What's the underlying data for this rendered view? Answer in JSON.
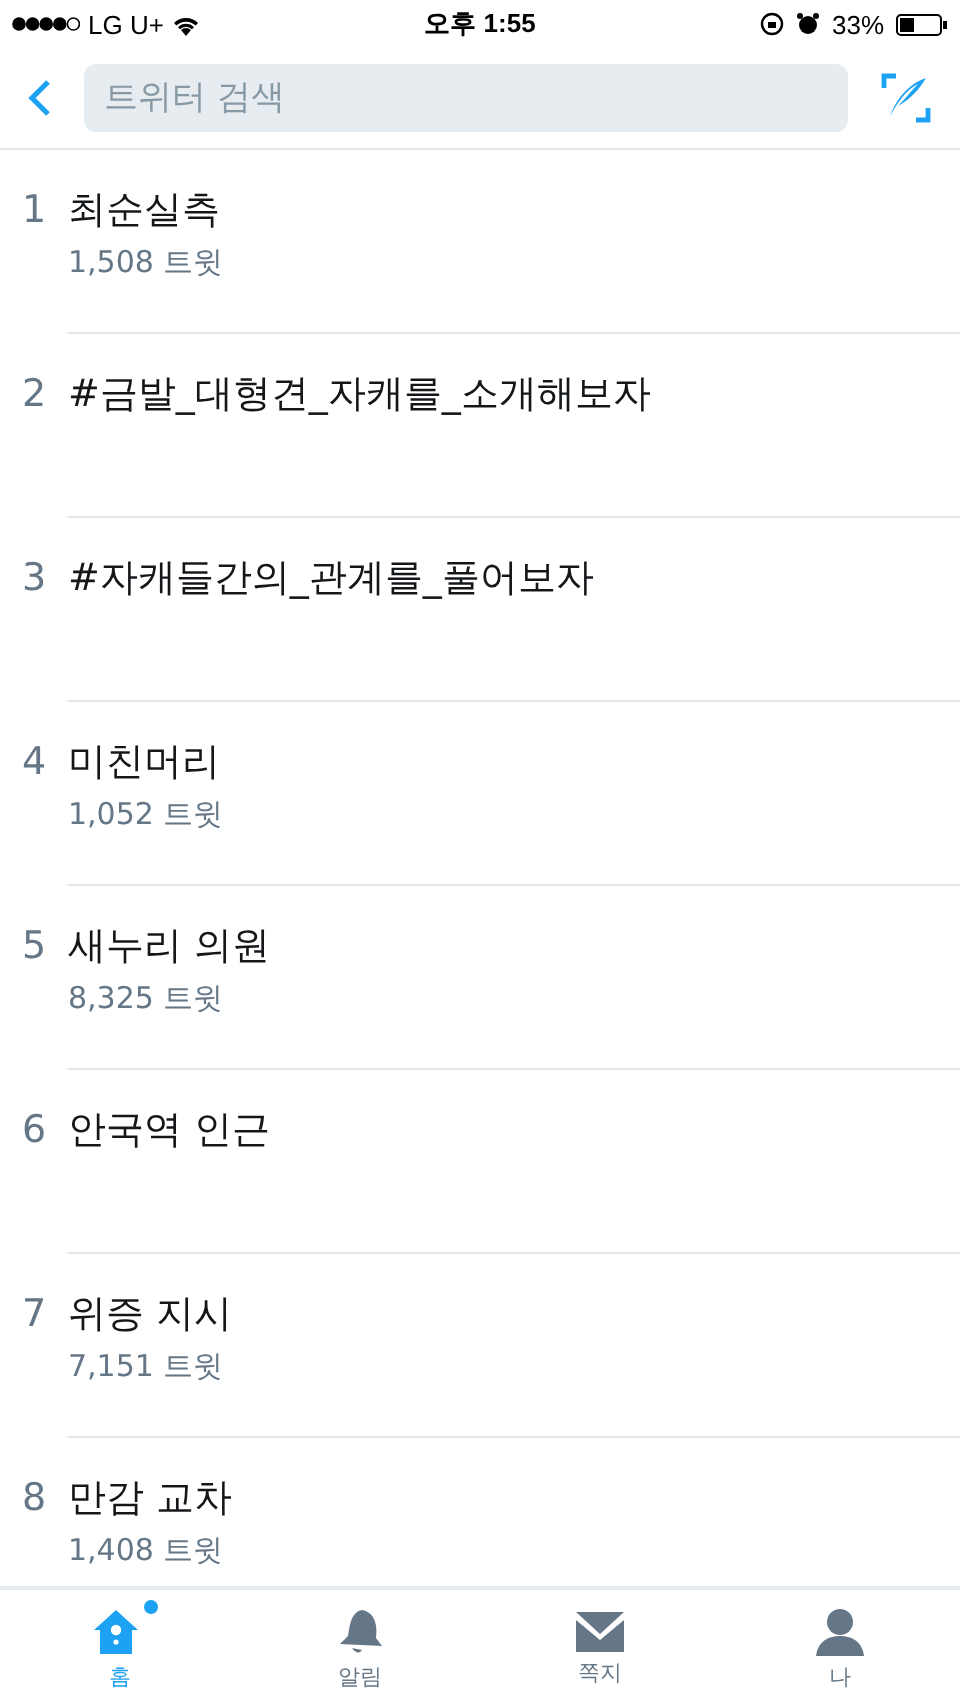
{
  "status_bar": {
    "carrier": "LG U+",
    "time": "오후 1:55",
    "battery": "33%"
  },
  "search": {
    "placeholder": "트위터 검색"
  },
  "trends": [
    {
      "rank": "1",
      "name": "최순실측",
      "count": "1,508 트윗"
    },
    {
      "rank": "2",
      "name": "#금발_대형견_자캐를_소개해보자"
    },
    {
      "rank": "3",
      "name": "#자캐들간의_관계를_풀어보자"
    },
    {
      "rank": "4",
      "name": "미친머리",
      "count": "1,052 트윗"
    },
    {
      "rank": "5",
      "name": "새누리 의원",
      "count": "8,325 트윗"
    },
    {
      "rank": "6",
      "name": "안국역 인근"
    },
    {
      "rank": "7",
      "name": "위증 지시",
      "count": "7,151 트윗"
    },
    {
      "rank": "8",
      "name": "만감 교차",
      "count": "1,408 트윗"
    }
  ],
  "tabs": [
    {
      "kind": "home",
      "label": "홈",
      "selected": true,
      "badge": true
    },
    {
      "kind": "bell",
      "label": "알림",
      "selected": false,
      "badge": false
    },
    {
      "kind": "mail",
      "label": "쪽지",
      "selected": false,
      "badge": false
    },
    {
      "kind": "person",
      "label": "나",
      "selected": false,
      "badge": false
    }
  ]
}
